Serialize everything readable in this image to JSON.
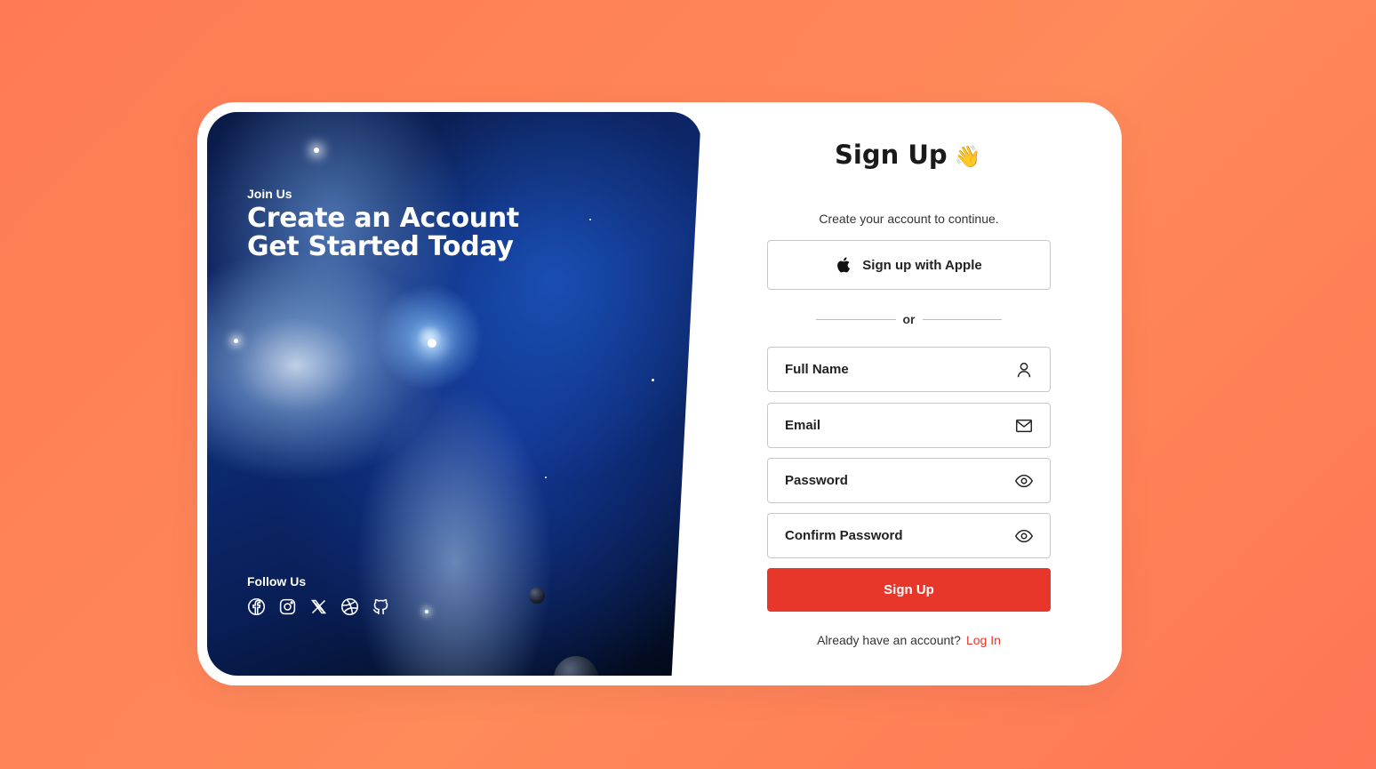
{
  "hero": {
    "eyebrow": "Join Us",
    "headline_line1": "Create an Account",
    "headline_line2": "Get Started Today",
    "follow_title": "Follow Us",
    "social_icons": [
      "facebook-icon",
      "instagram-icon",
      "x-icon",
      "dribbble-icon",
      "github-icon"
    ]
  },
  "form": {
    "title": "Sign Up",
    "title_emoji": "👋",
    "subtitle": "Create your account to continue.",
    "apple_button": "Sign up with Apple",
    "divider": "or",
    "fields": {
      "full_name": "Full Name",
      "email": "Email",
      "password": "Password",
      "confirm_password": "Confirm Password"
    },
    "submit": "Sign Up",
    "footer_text": "Already have an account?",
    "footer_link": "Log In"
  },
  "colors": {
    "accent": "#e8362b",
    "background": "#ff7f58"
  }
}
